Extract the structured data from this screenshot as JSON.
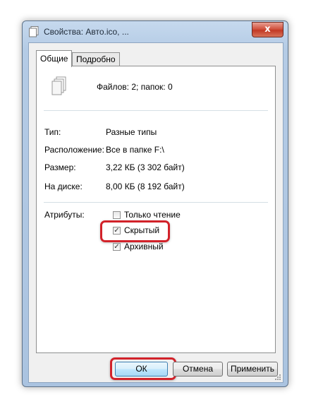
{
  "window": {
    "title": "Свойства: Авто.ico, ...",
    "close_glyph": "x"
  },
  "tabs": [
    {
      "label": "Общие",
      "active": true
    },
    {
      "label": "Подробно",
      "active": false
    }
  ],
  "general": {
    "summary": "Файлов: 2; папок: 0",
    "rows": [
      {
        "label": "Тип:",
        "value": "Разные типы"
      },
      {
        "label": "Расположение:",
        "value": "Все в папке F:\\"
      },
      {
        "label": "Размер:",
        "value": "3,22 КБ (3 302 байт)"
      },
      {
        "label": "На диске:",
        "value": "8,00 КБ (8 192 байт)"
      }
    ],
    "attributes_label": "Атрибуты:",
    "attributes": [
      {
        "label": "Только чтение",
        "checked": false
      },
      {
        "label": "Скрытый",
        "checked": true,
        "highlighted": true
      },
      {
        "label": "Архивный",
        "checked": true
      }
    ]
  },
  "buttons": {
    "ok": "ОК",
    "cancel": "Отмена",
    "apply": "Применить"
  },
  "colors": {
    "highlight": "#d2222a",
    "frame": "#b4cbe5"
  }
}
